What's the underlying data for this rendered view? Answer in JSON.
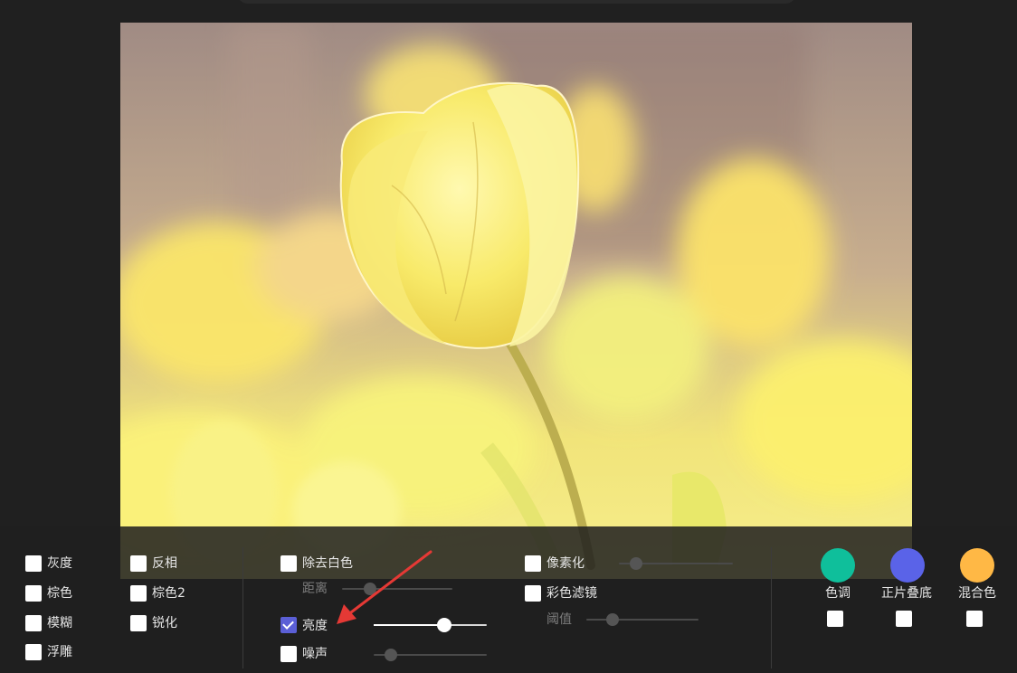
{
  "filters": {
    "grayscale": {
      "label": "灰度",
      "checked": false
    },
    "sepia": {
      "label": "棕色",
      "checked": false
    },
    "blur": {
      "label": "模糊",
      "checked": false
    },
    "emboss": {
      "label": "浮雕",
      "checked": false
    },
    "invert": {
      "label": "反相",
      "checked": false
    },
    "sepia2": {
      "label": "棕色2",
      "checked": false
    },
    "sharpen": {
      "label": "锐化",
      "checked": false
    },
    "remove_white": {
      "label": "除去白色",
      "checked": false,
      "sub_label": "距离",
      "value": 0.25,
      "enabled": false
    },
    "brightness": {
      "label": "亮度",
      "checked": true,
      "value": 0.62,
      "enabled": true
    },
    "noise": {
      "label": "噪声",
      "checked": false,
      "value": 0.15,
      "enabled": false
    },
    "pixelate": {
      "label": "像素化",
      "checked": false,
      "value": 0.15,
      "enabled": false
    },
    "color_filter": {
      "label": "彩色滤镜",
      "checked": false,
      "sub_label": "阈值",
      "value": 0.23,
      "enabled": false
    }
  },
  "blend": {
    "tint": {
      "label": "色调",
      "color": "#0fbf9b",
      "checked": false
    },
    "multiply": {
      "label": "正片叠底",
      "color": "#5a63e8",
      "checked": false
    },
    "blend": {
      "label": "混合色",
      "color": "#ffb845",
      "checked": false
    }
  },
  "colors": {
    "accent": "#5b5fd6",
    "background": "#202020",
    "annotation_arrow": "#e53935"
  }
}
